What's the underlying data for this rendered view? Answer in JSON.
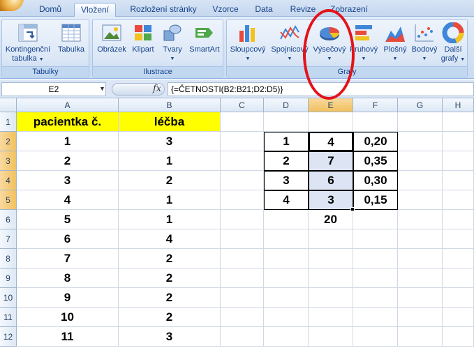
{
  "tabs": [
    "Domů",
    "Vložení",
    "Rozložení stránky",
    "Vzorce",
    "Data",
    "Revize",
    "Zobrazení"
  ],
  "active_tab": "Vložení",
  "ribbon": {
    "groups": {
      "tabulky": "Tabulky",
      "ilustrace": "Ilustrace",
      "grafy": "Grafy"
    },
    "buttons": {
      "kontingencni_line1": "Kontingenční",
      "kontingencni_line2": "tabulka",
      "tabulka": "Tabulka",
      "obrazek": "Obrázek",
      "klipart": "Klipart",
      "tvary": "Tvary",
      "smartart": "SmartArt",
      "sloupcovy": "Sloupcový",
      "spojnicovy": "Spojnicový",
      "vysecovy": "Výsečový",
      "pruhovy": "Pruhový",
      "plosny": "Plošný",
      "bodovy": "Bodový",
      "dalsi_line1": "Další",
      "dalsi_line2": "grafy"
    }
  },
  "formula_bar": {
    "name_box": "E2",
    "fx": "fx",
    "formula": "{=ČETNOSTI(B2:B21;D2:D5)}"
  },
  "sheet": {
    "columns": [
      "A",
      "B",
      "C",
      "D",
      "E",
      "F",
      "G",
      "H"
    ],
    "rows": [
      "1",
      "2",
      "3",
      "4",
      "5",
      "6",
      "7",
      "8",
      "9",
      "10",
      "11",
      "12"
    ],
    "header_A": "pacientka č.",
    "header_B": "léčba",
    "col_A": [
      "1",
      "2",
      "3",
      "4",
      "5",
      "6",
      "7",
      "8",
      "9",
      "10",
      "11"
    ],
    "col_B": [
      "3",
      "1",
      "2",
      "1",
      "1",
      "4",
      "2",
      "2",
      "2",
      "2",
      "3"
    ],
    "col_D": [
      "1",
      "2",
      "3",
      "4"
    ],
    "col_E": [
      "4",
      "7",
      "6",
      "3",
      "20"
    ],
    "col_F": [
      "0,20",
      "0,35",
      "0,30",
      "0,15"
    ]
  },
  "colors": {
    "header_fill": "#ffff00",
    "annotation_circle": "#e3131a"
  }
}
